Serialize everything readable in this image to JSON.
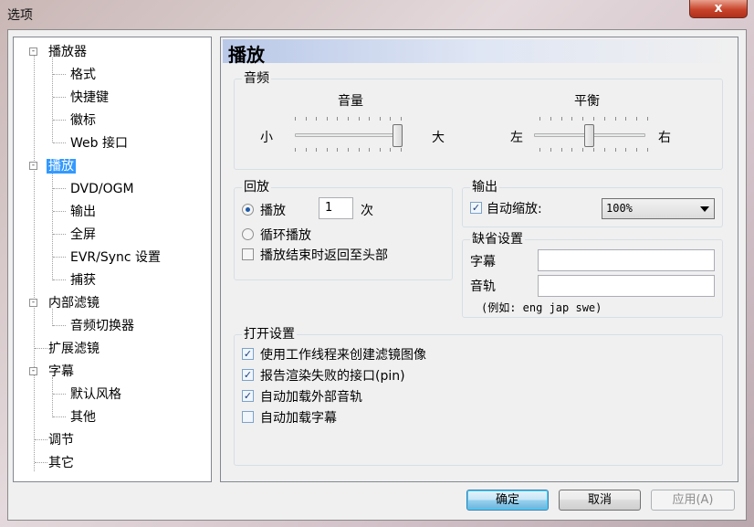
{
  "window": {
    "title": "选项",
    "close_glyph": "x"
  },
  "tree": {
    "items": [
      {
        "label": "播放器",
        "expander": "-",
        "selected": false
      },
      {
        "label": "格式"
      },
      {
        "label": "快捷键"
      },
      {
        "label": "徽标"
      },
      {
        "label": "Web 接口"
      },
      {
        "label": "播放",
        "expander": "-",
        "selected": true
      },
      {
        "label": "DVD/OGM"
      },
      {
        "label": "输出"
      },
      {
        "label": "全屏"
      },
      {
        "label": "EVR/Sync 设置"
      },
      {
        "label": "捕获"
      },
      {
        "label": "内部滤镜",
        "expander": "-"
      },
      {
        "label": "音频切换器"
      },
      {
        "label": "扩展滤镜"
      },
      {
        "label": "字幕",
        "expander": "-"
      },
      {
        "label": "默认风格"
      },
      {
        "label": "其他"
      },
      {
        "label": "调节"
      },
      {
        "label": "其它"
      }
    ]
  },
  "panel": {
    "title": "播放",
    "audio": {
      "legend": "音频",
      "volume_label": "音量",
      "volume_min": "小",
      "volume_max": "大",
      "volume_value": 1.0,
      "balance_label": "平衡",
      "balance_left": "左",
      "balance_right": "右",
      "balance_value": 0.5
    },
    "playback": {
      "legend": "回放",
      "play_label": "播放",
      "play_count": "1",
      "times_label": "次",
      "loop_label": "循环播放",
      "rewind_label": "播放结束时返回至头部",
      "play_selected": true,
      "loop_selected": false,
      "rewind_checked": false
    },
    "output": {
      "legend": "输出",
      "autozoom_label": "自动缩放:",
      "autozoom_checked": true,
      "zoom_value": "100%"
    },
    "defaults": {
      "legend": "缺省设置",
      "subtitle_label": "字幕",
      "subtitle_value": "",
      "audio_track_label": "音轨",
      "audio_track_value": "",
      "example_text": "(例如: eng jap swe)"
    },
    "open_settings": {
      "legend": "打开设置",
      "options": [
        {
          "label": "使用工作线程来创建滤镜图像",
          "checked": true
        },
        {
          "label": "报告渲染失败的接口(pin)",
          "checked": true
        },
        {
          "label": "自动加载外部音轨",
          "checked": true
        },
        {
          "label": "自动加载字幕",
          "checked": false
        }
      ]
    }
  },
  "buttons": {
    "ok": "确定",
    "cancel": "取消",
    "apply": "应用(A)"
  },
  "icons": {
    "check": "✓",
    "combo_arrow": "chevron-down-icon"
  }
}
